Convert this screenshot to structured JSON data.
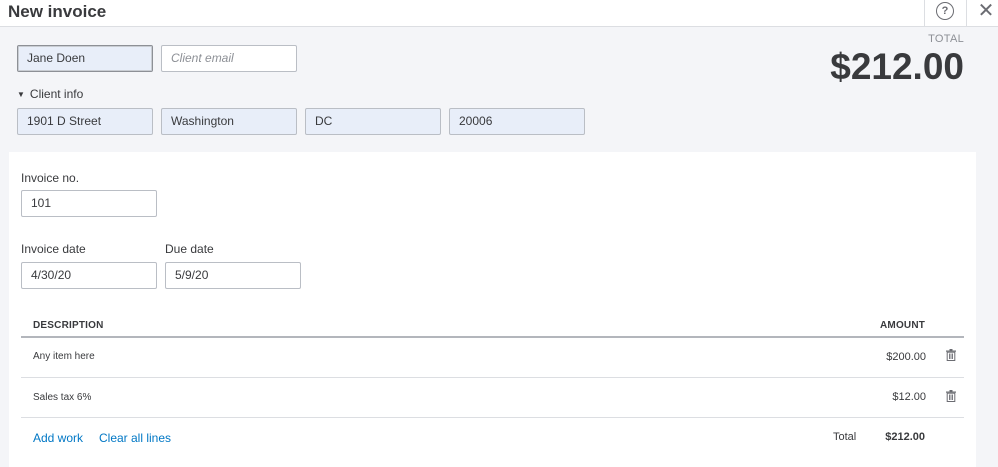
{
  "header": {
    "title": "New invoice",
    "help_icon": "?",
    "close_icon": "✕"
  },
  "client": {
    "name": "Jane Doen",
    "email_placeholder": "Client email",
    "info_toggle": "Client info",
    "street": "1901 D Street",
    "city": "Washington",
    "state": "DC",
    "zip": "20006"
  },
  "summary": {
    "total_label": "TOTAL",
    "total_amount": "$212.00"
  },
  "invoice": {
    "number_label": "Invoice no.",
    "number": "101",
    "date_label": "Invoice date",
    "date": "4/30/20",
    "due_label": "Due date",
    "due": "5/9/20"
  },
  "table": {
    "headers": {
      "description": "DESCRIPTION",
      "amount": "AMOUNT"
    },
    "rows": [
      {
        "description": "Any item here",
        "amount": "$200.00"
      },
      {
        "description": "Sales tax 6%",
        "amount": "$12.00"
      }
    ],
    "add_work": "Add work",
    "clear_lines": "Clear all lines",
    "total_label": "Total",
    "total_value": "$212.00"
  },
  "colors": {
    "link": "#0077c5",
    "field_fill": "#e8eef9",
    "text": "#393a3d"
  },
  "icons": {
    "help": "help-icon",
    "close": "close-icon",
    "caret": "caret-down-icon",
    "trash": "trash-icon"
  }
}
